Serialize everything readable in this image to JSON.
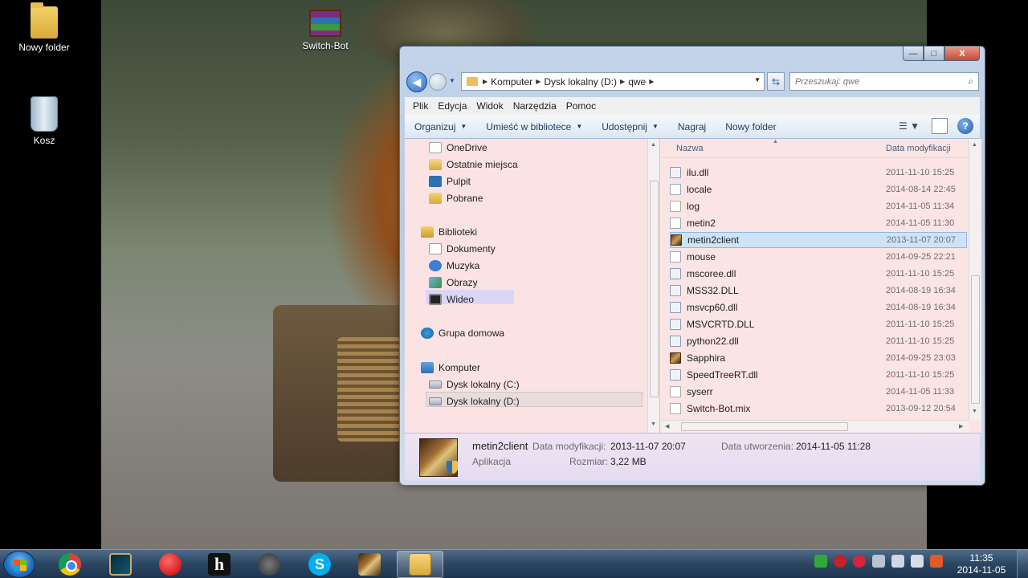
{
  "desktop": {
    "icons": [
      {
        "label": "Nowy folder"
      },
      {
        "label": "Kosz"
      },
      {
        "label": "Switch-Bot"
      }
    ]
  },
  "window": {
    "controls": {
      "minimize": "—",
      "maximize": "□",
      "close": "X"
    },
    "address": {
      "segments": [
        "Komputer",
        "Dysk lokalny (D:)",
        "qwe"
      ]
    },
    "search": {
      "placeholder": "Przeszukaj: qwe"
    },
    "menu": [
      "Plik",
      "Edycja",
      "Widok",
      "Narzędzia",
      "Pomoc"
    ],
    "commands": {
      "organize": "Organizuj",
      "include_library": "Umieść w bibliotece",
      "share": "Udostępnij",
      "burn": "Nagraj",
      "new_folder": "Nowy folder"
    },
    "nav_pane": {
      "items": [
        {
          "label": "OneDrive",
          "icon": "cloud-icon"
        },
        {
          "label": "Ostatnie miejsca",
          "icon": "recent-places-icon"
        },
        {
          "label": "Pulpit",
          "icon": "desktop-icon"
        },
        {
          "label": "Pobrane",
          "icon": "downloads-icon"
        },
        {
          "label": "Biblioteki",
          "icon": "libraries-icon"
        },
        {
          "label": "Dokumenty",
          "icon": "documents-icon"
        },
        {
          "label": "Muzyka",
          "icon": "music-icon"
        },
        {
          "label": "Obrazy",
          "icon": "pictures-icon"
        },
        {
          "label": "Wideo",
          "icon": "video-icon"
        },
        {
          "label": "Grupa domowa",
          "icon": "homegroup-icon"
        },
        {
          "label": "Komputer",
          "icon": "computer-icon"
        },
        {
          "label": "Dysk lokalny (C:)",
          "icon": "drive-icon"
        },
        {
          "label": "Dysk lokalny (D:)",
          "icon": "drive-icon"
        }
      ]
    },
    "file_list": {
      "columns": {
        "name": "Nazwa",
        "date": "Data modyfikacji"
      },
      "rows": [
        {
          "name": "ilu.dll",
          "date": "2011-11-10 15:25",
          "type": "dll"
        },
        {
          "name": "locale",
          "date": "2014-08-14 22:45",
          "type": "folder"
        },
        {
          "name": "log",
          "date": "2014-11-05 11:34",
          "type": "file"
        },
        {
          "name": "metin2",
          "date": "2014-11-05 11:30",
          "type": "folder"
        },
        {
          "name": "metin2client",
          "date": "2013-11-07 20:07",
          "type": "app",
          "selected": true
        },
        {
          "name": "mouse",
          "date": "2014-09-25 22:21",
          "type": "folder"
        },
        {
          "name": "mscoree.dll",
          "date": "2011-11-10 15:25",
          "type": "dll"
        },
        {
          "name": "MSS32.DLL",
          "date": "2014-08-19 16:34",
          "type": "dll"
        },
        {
          "name": "msvcp60.dll",
          "date": "2014-08-19 16:34",
          "type": "dll"
        },
        {
          "name": "MSVCRTD.DLL",
          "date": "2011-11-10 15:25",
          "type": "dll"
        },
        {
          "name": "python22.dll",
          "date": "2011-11-10 15:25",
          "type": "dll"
        },
        {
          "name": "Sapphira",
          "date": "2014-09-25 23:03",
          "type": "app"
        },
        {
          "name": "SpeedTreeRT.dll",
          "date": "2011-11-10 15:25",
          "type": "dll"
        },
        {
          "name": "syserr",
          "date": "2014-11-05 11:33",
          "type": "file"
        },
        {
          "name": "Switch-Bot.mix",
          "date": "2013-09-12 20:54",
          "type": "file"
        }
      ]
    },
    "details": {
      "name": "metin2client",
      "type": "Aplikacja",
      "modified_label": "Data modyfikacji:",
      "modified_value": "2013-11-07 20:07",
      "size_label": "Rozmiar:",
      "size_value": "3,22 MB",
      "created_label": "Data utworzenia:",
      "created_value": "2014-11-05 11:28"
    }
  },
  "taskbar": {
    "clock": {
      "time": "11:35",
      "date": "2014-11-05"
    },
    "skype_letter": "S",
    "h_letter": "h",
    "tray_expand": "▲"
  },
  "colors": {
    "accent": "#2b6cc4",
    "selection": "#cde3f8",
    "pane_tint": "#fbe4e4"
  }
}
